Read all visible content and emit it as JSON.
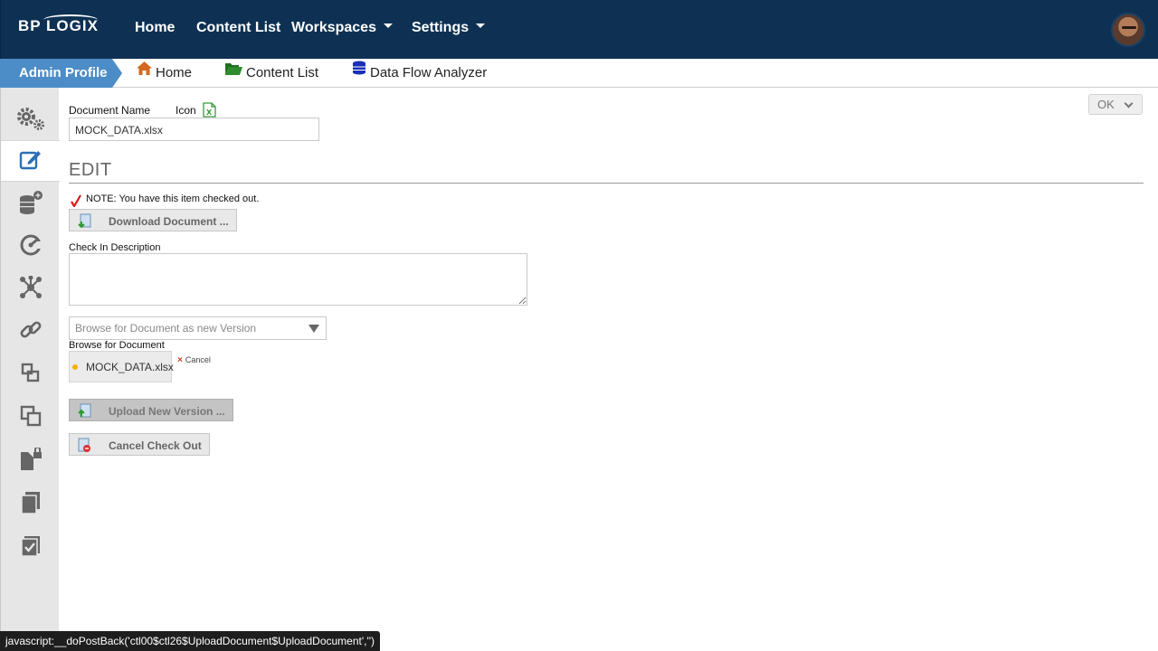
{
  "topnav": {
    "logo": "BP LOGIX",
    "items": [
      {
        "label": "Home",
        "has_caret": false
      },
      {
        "label": "Content List",
        "has_caret": false
      },
      {
        "label": "Workspaces",
        "has_caret": true
      },
      {
        "label": "Settings",
        "has_caret": true
      }
    ]
  },
  "breadcrumb": {
    "active": "Admin Profile",
    "links": [
      {
        "label": "Home",
        "icon": "home-icon"
      },
      {
        "label": "Content List",
        "icon": "folder-icon"
      },
      {
        "label": "Data Flow Analyzer",
        "icon": "database-icon"
      }
    ]
  },
  "sidebar": {
    "items": [
      "gears-icon",
      "edit-icon",
      "database-add-icon",
      "dashboard-gauge-icon",
      "network-icon",
      "link-icon",
      "move-icon",
      "copy-icon",
      "lock-document-icon",
      "duplicate-icon",
      "checked-document-icon"
    ],
    "active_index": 1
  },
  "form": {
    "doc_name_label": "Document Name",
    "icon_label": "Icon",
    "doc_name_value": "MOCK_DATA.xlsx",
    "ok_label": "OK",
    "section_title": "EDIT",
    "note": "NOTE: You have this item checked out.",
    "download_button": "Download Document ...",
    "checkin_label": "Check In Description",
    "checkin_value": "",
    "browse_select": "Browse for Document as new Version",
    "browse_label": "Browse for Document",
    "file_name": "MOCK_DATA.xlsx",
    "cancel_label": "Cancel",
    "upload_button": "Upload New Version ...",
    "cancel_checkout_button": "Cancel Check Out"
  },
  "status_bar": "javascript:__doPostBack('ctl00$ctl26$UploadDocument$UploadDocument','')",
  "colors": {
    "topbar": "#0e3153",
    "breadcrumb_active": "#4d8dc7",
    "sidebar": "#e6e6e6",
    "accent_icon": "#2a6eb5"
  }
}
